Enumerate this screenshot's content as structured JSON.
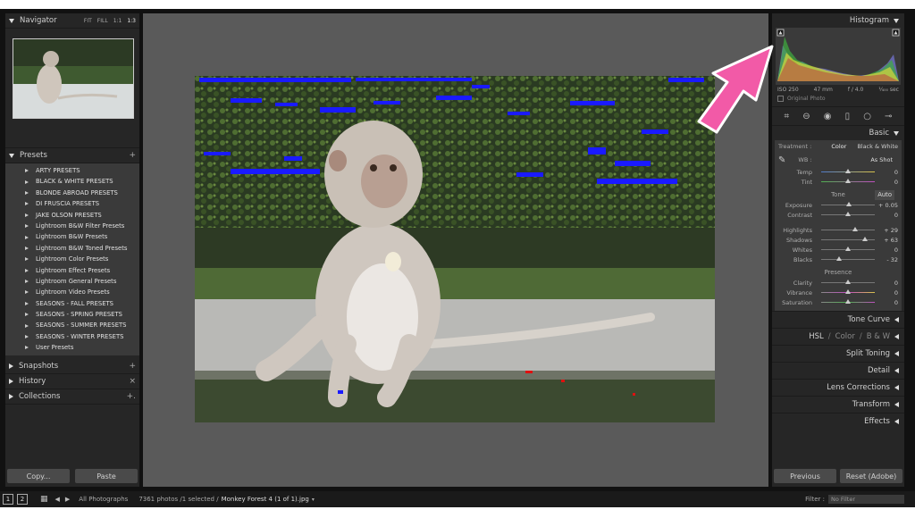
{
  "navigator": {
    "title": "Navigator",
    "zoom_options": [
      "FIT",
      "FILL",
      "1:1",
      "1:3"
    ]
  },
  "presets": {
    "title": "Presets",
    "add": "+",
    "items": [
      "ARTY PRESETS",
      "BLACK & WHITE PRESETS",
      "BLONDE ABROAD PRESETS",
      "DI FRUSCIA PRESETS",
      "JAKE OLSON PRESETS",
      "Lightroom B&W Filter Presets",
      "Lightroom B&W Presets",
      "Lightroom B&W Toned Presets",
      "Lightroom Color Presets",
      "Lightroom Effect Presets",
      "Lightroom General Presets",
      "Lightroom Video Presets",
      "SEASONS - FALL PRESETS",
      "SEASONS - SPRING PRESETS",
      "SEASONS - SUMMER PRESETS",
      "SEASONS - WINTER PRESETS",
      "User Presets"
    ]
  },
  "snapshots": {
    "title": "Snapshots",
    "act": "+"
  },
  "history": {
    "title": "History",
    "act": "×"
  },
  "collections": {
    "title": "Collections",
    "act": "+."
  },
  "left_buttons": {
    "copy": "Copy...",
    "paste": "Paste"
  },
  "histogram": {
    "title": "Histogram",
    "iso": "ISO 250",
    "focal": "47 mm",
    "aperture": "f / 4.0",
    "shutter": "¹⁄₄₀₀ sec",
    "original_photo": "Original Photo"
  },
  "basic": {
    "title": "Basic",
    "treatment_label": "Treatment :",
    "color": "Color",
    "bw": "Black & White",
    "wb_label": "WB :",
    "wb_value": "As Shot",
    "temp": {
      "label": "Temp",
      "value": "0",
      "pos": 0.5
    },
    "tint": {
      "label": "Tint",
      "value": "0",
      "pos": 0.5
    },
    "tone_label": "Tone",
    "auto": "Auto",
    "exposure": {
      "label": "Exposure",
      "value": "+ 0.05",
      "pos": 0.51
    },
    "contrast": {
      "label": "Contrast",
      "value": "0",
      "pos": 0.5
    },
    "highlights": {
      "label": "Highlights",
      "value": "+ 29",
      "pos": 0.64
    },
    "shadows": {
      "label": "Shadows",
      "value": "+ 63",
      "pos": 0.81
    },
    "whites": {
      "label": "Whites",
      "value": "0",
      "pos": 0.5
    },
    "blacks": {
      "label": "Blacks",
      "value": "- 32",
      "pos": 0.34
    },
    "presence_label": "Presence",
    "clarity": {
      "label": "Clarity",
      "value": "0",
      "pos": 0.5
    },
    "vibrance": {
      "label": "Vibrance",
      "value": "0",
      "pos": 0.5
    },
    "saturation": {
      "label": "Saturation",
      "value": "0",
      "pos": 0.5
    }
  },
  "sections": {
    "tone_curve": "Tone Curve",
    "hsl": "HSL",
    "color": "Color",
    "bw": "B & W",
    "split_toning": "Split Toning",
    "detail": "Detail",
    "lens_corrections": "Lens Corrections",
    "transform": "Transform",
    "effects": "Effects"
  },
  "right_buttons": {
    "previous": "Previous",
    "reset": "Reset (Adobe)"
  },
  "filmstrip": {
    "page1": "1",
    "page2": "2",
    "source": "All Photographs",
    "count": "7361 photos /1 selected /",
    "filename": "Monkey Forest 4 (1 of 1).jpg",
    "filter_label": "Filter :",
    "filter_value": "No Filter"
  },
  "colors": {
    "accent_arrow": "#f25aa7",
    "clipping_blue": "#1a1aff",
    "clipping_red": "#e01010"
  }
}
